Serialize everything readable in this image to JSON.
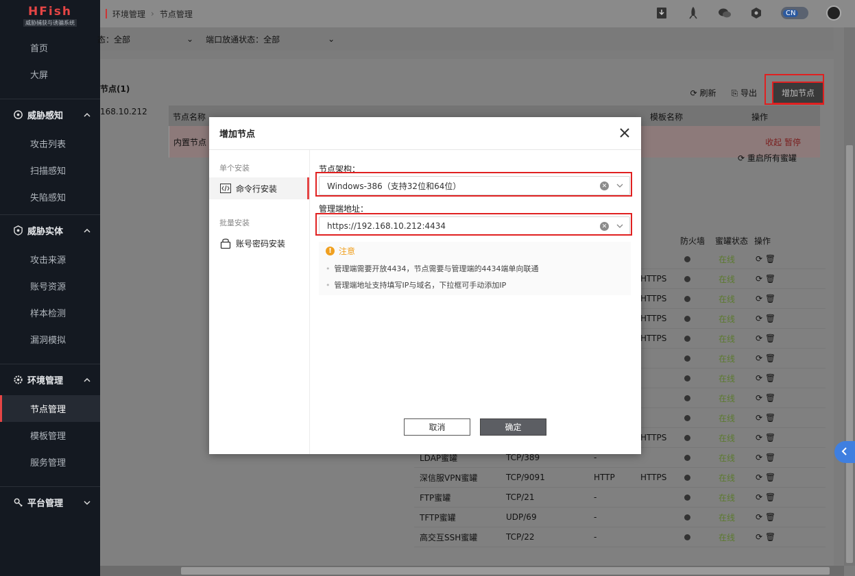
{
  "sidebar": {
    "brand": "HFish",
    "brand_sub": "威胁捕获与诱骗系统",
    "top_items": [
      "首页",
      "大屏"
    ],
    "groups": [
      {
        "label": "威胁感知",
        "items": [
          "攻击列表",
          "扫描感知",
          "失陷感知"
        ]
      },
      {
        "label": "威胁实体",
        "items": [
          "攻击来源",
          "账号资源",
          "样本检测",
          "漏洞模拟"
        ]
      },
      {
        "label": "环境管理",
        "items": [
          "节点管理",
          "模板管理",
          "服务管理"
        ]
      },
      {
        "label": "平台管理",
        "items": []
      }
    ],
    "active_item": "节点管理"
  },
  "topbar": {
    "breadcrumb": [
      "环境管理",
      "节点管理"
    ],
    "lang": "CN"
  },
  "filterbar": {
    "filter1": "态：全部",
    "filter2": "端口放通状态：全部"
  },
  "card": {
    "title": "节点(1)",
    "sub": "168.10.212",
    "refresh": "刷新",
    "export": "导出",
    "add_node": "增加节点",
    "headers": [
      "节点名称",
      "模板名称",
      "操作"
    ],
    "builtin_row": {
      "name": "内置节点",
      "ops": "收起  暂停"
    },
    "restart_all": "重启所有蜜罐",
    "svc_headers": {
      "firewall": "防火墙",
      "status": "蜜罐状态",
      "op": "操作"
    }
  },
  "services": [
    {
      "name": "",
      "port": "",
      "proto": "",
      "proto2": "",
      "status": "在线"
    },
    {
      "name": "",
      "port": "",
      "proto": "",
      "proto2": "HTTPS",
      "status": "在线"
    },
    {
      "name": "",
      "port": "",
      "proto": "",
      "proto2": "HTTPS",
      "status": "在线"
    },
    {
      "name": "",
      "port": "",
      "proto": "",
      "proto2": "HTTPS",
      "status": "在线"
    },
    {
      "name": "",
      "port": "",
      "proto": "",
      "proto2": "HTTPS",
      "status": "在线"
    },
    {
      "name": "",
      "port": "",
      "proto": "",
      "proto2": "",
      "status": "在线"
    },
    {
      "name": "",
      "port": "",
      "proto": "",
      "proto2": "",
      "status": "在线"
    },
    {
      "name": "",
      "port": "",
      "proto": "",
      "proto2": "",
      "status": "在线"
    },
    {
      "name": "",
      "port": "",
      "proto": "",
      "proto2": "",
      "status": "在线"
    },
    {
      "name": "",
      "port": "",
      "proto": "",
      "proto2": "HTTPS",
      "status": "在线"
    },
    {
      "name": "LDAP蜜罐",
      "port": "TCP/389",
      "proto": "-",
      "proto2": "",
      "status": "在线"
    },
    {
      "name": "深信服VPN蜜罐",
      "port": "TCP/9091",
      "proto": "HTTP",
      "proto2": "HTTPS",
      "status": "在线"
    },
    {
      "name": "FTP蜜罐",
      "port": "TCP/21",
      "proto": "-",
      "proto2": "",
      "status": "在线"
    },
    {
      "name": "TFTP蜜罐",
      "port": "UDP/69",
      "proto": "-",
      "proto2": "",
      "status": "在线"
    },
    {
      "name": "高交互SSH蜜罐",
      "port": "TCP/22",
      "proto": "-",
      "proto2": "",
      "status": "在线"
    }
  ],
  "modal": {
    "title": "增加节点",
    "left": {
      "section1": "单个安装",
      "item1": "命令行安装",
      "section2": "批量安装",
      "item2": "账号密码安装"
    },
    "arch_label": "节点架构：",
    "arch_value": "Windows-386（支持32位和64位）",
    "addr_label": "管理端地址：",
    "addr_value": "https://192.168.10.212:4434",
    "notice_title": "注意",
    "notice_lines": [
      "管理端需要开放4434，节点需要与管理端的4434端单向联通",
      "管理端地址支持填写IP与域名，下拉框可手动添加IP"
    ],
    "cancel": "取消",
    "ok": "确定"
  }
}
